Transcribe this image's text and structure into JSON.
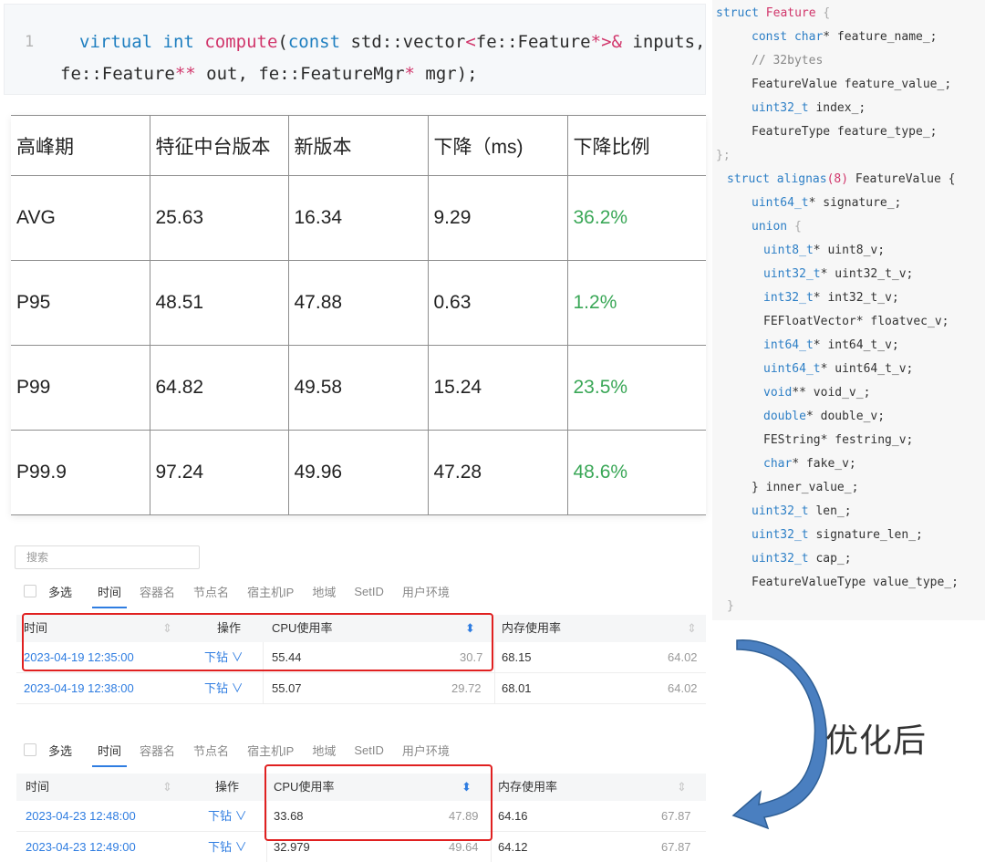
{
  "code_top": {
    "line_number": "1",
    "line1": {
      "kw1": "virtual",
      "kw2": "int",
      "fn": "compute",
      "p1": "(",
      "kw3": "const",
      "t1": " std::vector",
      "lt": "<",
      "t2": "fe::Feature",
      "star": "*",
      "gt": ">",
      "amp": "&",
      "t3": " inputs,"
    },
    "line2": {
      "t1": "fe::Feature",
      "stars": "**",
      "t2": " out, fe::FeatureMgr",
      "star": "*",
      "t3": " mgr",
      "p2": ");"
    }
  },
  "perf_table": {
    "headers": [
      "高峰期",
      "特征中台版本",
      "新版本",
      "下降（ms)",
      "下降比例"
    ],
    "rows": [
      [
        "AVG",
        "25.63",
        "16.34",
        "9.29",
        "36.2%"
      ],
      [
        "P95",
        "48.51",
        "47.88",
        "0.63",
        "1.2%"
      ],
      [
        "P99",
        "64.82",
        "49.58",
        "15.24",
        "23.5%"
      ],
      [
        "P99.9",
        "97.24",
        "49.96",
        "47.28",
        "48.6%"
      ]
    ]
  },
  "code_right": {
    "l01": {
      "a": "struct ",
      "b": "Feature",
      "c": " {"
    },
    "l02": {
      "a": "const ",
      "b": "char",
      "c": "* feature_name_;"
    },
    "l03": {
      "a": "// 32bytes"
    },
    "l04": {
      "a": "FeatureValue feature_value_;"
    },
    "l05": {
      "a": "uint32_t",
      "b": " index_;"
    },
    "l06": {
      "a": "FeatureType feature_type_;"
    },
    "l07": {
      "a": "};"
    },
    "l08": {
      "a": "struct ",
      "b": "alignas",
      "c": "(8)",
      "d": " FeatureValue {"
    },
    "l09": {
      "a": "uint64_t",
      "b": "* signature_;"
    },
    "l10": {
      "a": "union",
      "b": " {"
    },
    "l11": {
      "a": "uint8_t",
      "b": "* uint8_v;"
    },
    "l12": {
      "a": "uint32_t",
      "b": "* uint32_t_v;"
    },
    "l13": {
      "a": "int32_t",
      "b": "* int32_t_v;"
    },
    "l14": {
      "a": "FEFloatVector* floatvec_v;"
    },
    "l15": {
      "a": "int64_t",
      "b": "* int64_t_v;"
    },
    "l16": {
      "a": "uint64_t",
      "b": "* uint64_t_v;"
    },
    "l17": {
      "a": "void",
      "b": "** void_v_;"
    },
    "l18": {
      "a": "double",
      "b": "* double_v;"
    },
    "l19": {
      "a": "FEString* festring_v;"
    },
    "l20": {
      "a": "char",
      "b": "* fake_v;"
    },
    "l21": {
      "a": "} inner_value_;"
    },
    "l22": {
      "a": "uint32_t",
      "b": " len_;"
    },
    "l23": {
      "a": "uint32_t",
      "b": " signature_len_;"
    },
    "l24": {
      "a": "uint32_t",
      "b": " cap_;"
    },
    "l25": {
      "a": "FeatureValueType value_type_;"
    },
    "l26": {
      "a": "}"
    }
  },
  "monitor": {
    "search_placeholder": "搜索",
    "tabs": [
      "多选",
      "时间",
      "容器名",
      "节点名",
      "宿主机IP",
      "地域",
      "SetID",
      "用户环境"
    ],
    "columns": [
      "时间",
      "操作",
      "CPU使用率",
      "内存使用率"
    ],
    "sort_glyph": "⇕",
    "sort_active_glyph": "⬍",
    "before": [
      {
        "time": "2023-04-19 12:35:00",
        "action": "下钻 ∨",
        "cpu": "55.44",
        "cpu2": "30.7",
        "mem": "68.15",
        "mem2": "64.02"
      },
      {
        "time": "2023-04-19 12:38:00",
        "action": "下钻 ∨",
        "cpu": "55.07",
        "cpu2": "29.72",
        "mem": "68.01",
        "mem2": "64.02"
      }
    ],
    "after": [
      {
        "time": "2023-04-23 12:48:00",
        "action": "下钻 ∨",
        "cpu": "33.68",
        "cpu2": "47.89",
        "mem": "64.16",
        "mem2": "67.87"
      },
      {
        "time": "2023-04-23 12:49:00",
        "action": "下钻 ∨",
        "cpu": "32.979",
        "cpu2": "49.64",
        "mem": "64.12",
        "mem2": "67.87"
      }
    ]
  },
  "arrow_label": "优化后",
  "colors": {
    "accent_blue": "#2f7de1",
    "highlight_red": "#e02020",
    "good_green": "#3aa757",
    "arrow_blue": "#4a7fc0"
  }
}
